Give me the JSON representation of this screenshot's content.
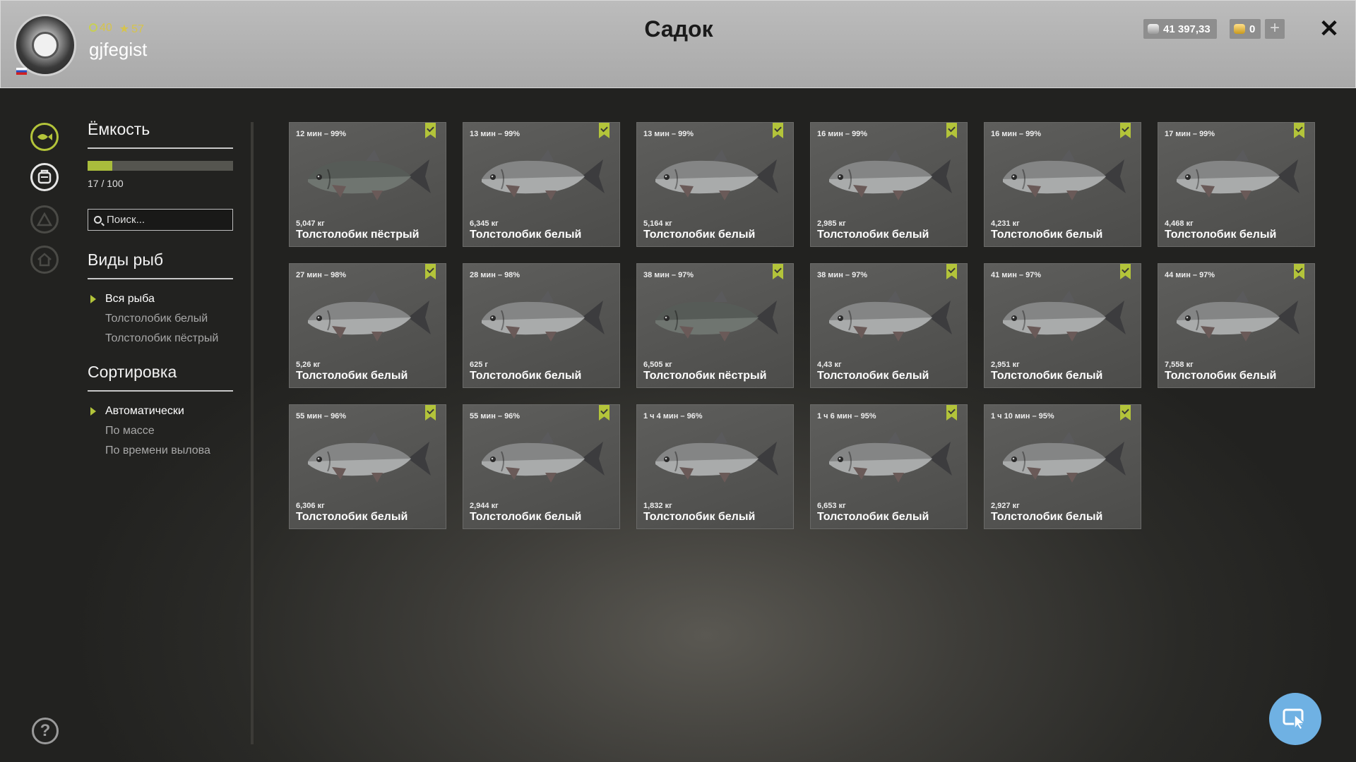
{
  "player": {
    "level": "40",
    "rank": "57",
    "username": "gjfegist"
  },
  "title": "Садок",
  "currency": {
    "silver": "41 397,33",
    "gold": "0"
  },
  "panel": {
    "capacity_title": "Ёмкость",
    "capacity_text": "17 / 100",
    "capacity_fraction": 0.17,
    "search_placeholder": "Поиск...",
    "species_title": "Виды рыб",
    "species": [
      "Вся рыба",
      "Толстолобик белый",
      "Толстолобик пёстрый"
    ],
    "sort_title": "Сортировка",
    "sort": [
      "Автоматически",
      "По массе",
      "По времени вылова"
    ]
  },
  "colors": {
    "accent": "#b3c43a",
    "header": "#b0b0b0",
    "card": "#555553",
    "cursor_button": "#6fb1e3"
  },
  "fish": [
    {
      "time": "12 мин – 99%",
      "weight": "5,047 кг",
      "name": "Толстолобик пёстрый",
      "marked": true,
      "variant": "spotted"
    },
    {
      "time": "13 мин – 99%",
      "weight": "6,345 кг",
      "name": "Толстолобик белый",
      "marked": true,
      "variant": "white"
    },
    {
      "time": "13 мин – 99%",
      "weight": "5,164 кг",
      "name": "Толстолобик белый",
      "marked": true,
      "variant": "white"
    },
    {
      "time": "16 мин – 99%",
      "weight": "2,985 кг",
      "name": "Толстолобик белый",
      "marked": true,
      "variant": "white"
    },
    {
      "time": "16 мин – 99%",
      "weight": "4,231 кг",
      "name": "Толстолобик белый",
      "marked": true,
      "variant": "white"
    },
    {
      "time": "17 мин – 99%",
      "weight": "4,468 кг",
      "name": "Толстолобик белый",
      "marked": true,
      "variant": "white"
    },
    {
      "time": "27 мин – 98%",
      "weight": "5,26 кг",
      "name": "Толстолобик белый",
      "marked": true,
      "variant": "white"
    },
    {
      "time": "28 мин – 98%",
      "weight": "625 г",
      "name": "Толстолобик белый",
      "marked": false,
      "variant": "white"
    },
    {
      "time": "38 мин – 97%",
      "weight": "6,505 кг",
      "name": "Толстолобик пёстрый",
      "marked": true,
      "variant": "spotted"
    },
    {
      "time": "38 мин – 97%",
      "weight": "4,43 кг",
      "name": "Толстолобик белый",
      "marked": true,
      "variant": "white"
    },
    {
      "time": "41 мин – 97%",
      "weight": "2,951 кг",
      "name": "Толстолобик белый",
      "marked": true,
      "variant": "white"
    },
    {
      "time": "44 мин – 97%",
      "weight": "7,558 кг",
      "name": "Толстолобик белый",
      "marked": true,
      "variant": "white"
    },
    {
      "time": "55 мин – 96%",
      "weight": "6,306 кг",
      "name": "Толстолобик белый",
      "marked": true,
      "variant": "white"
    },
    {
      "time": "55 мин – 96%",
      "weight": "2,944 кг",
      "name": "Толстолобик белый",
      "marked": true,
      "variant": "white"
    },
    {
      "time": "1 ч 4 мин – 96%",
      "weight": "1,832 кг",
      "name": "Толстолобик белый",
      "marked": false,
      "variant": "white"
    },
    {
      "time": "1 ч 6 мин – 95%",
      "weight": "6,653 кг",
      "name": "Толстолобик белый",
      "marked": true,
      "variant": "white"
    },
    {
      "time": "1 ч 10 мин – 95%",
      "weight": "2,927 кг",
      "name": "Толстолобик белый",
      "marked": true,
      "variant": "white"
    }
  ]
}
